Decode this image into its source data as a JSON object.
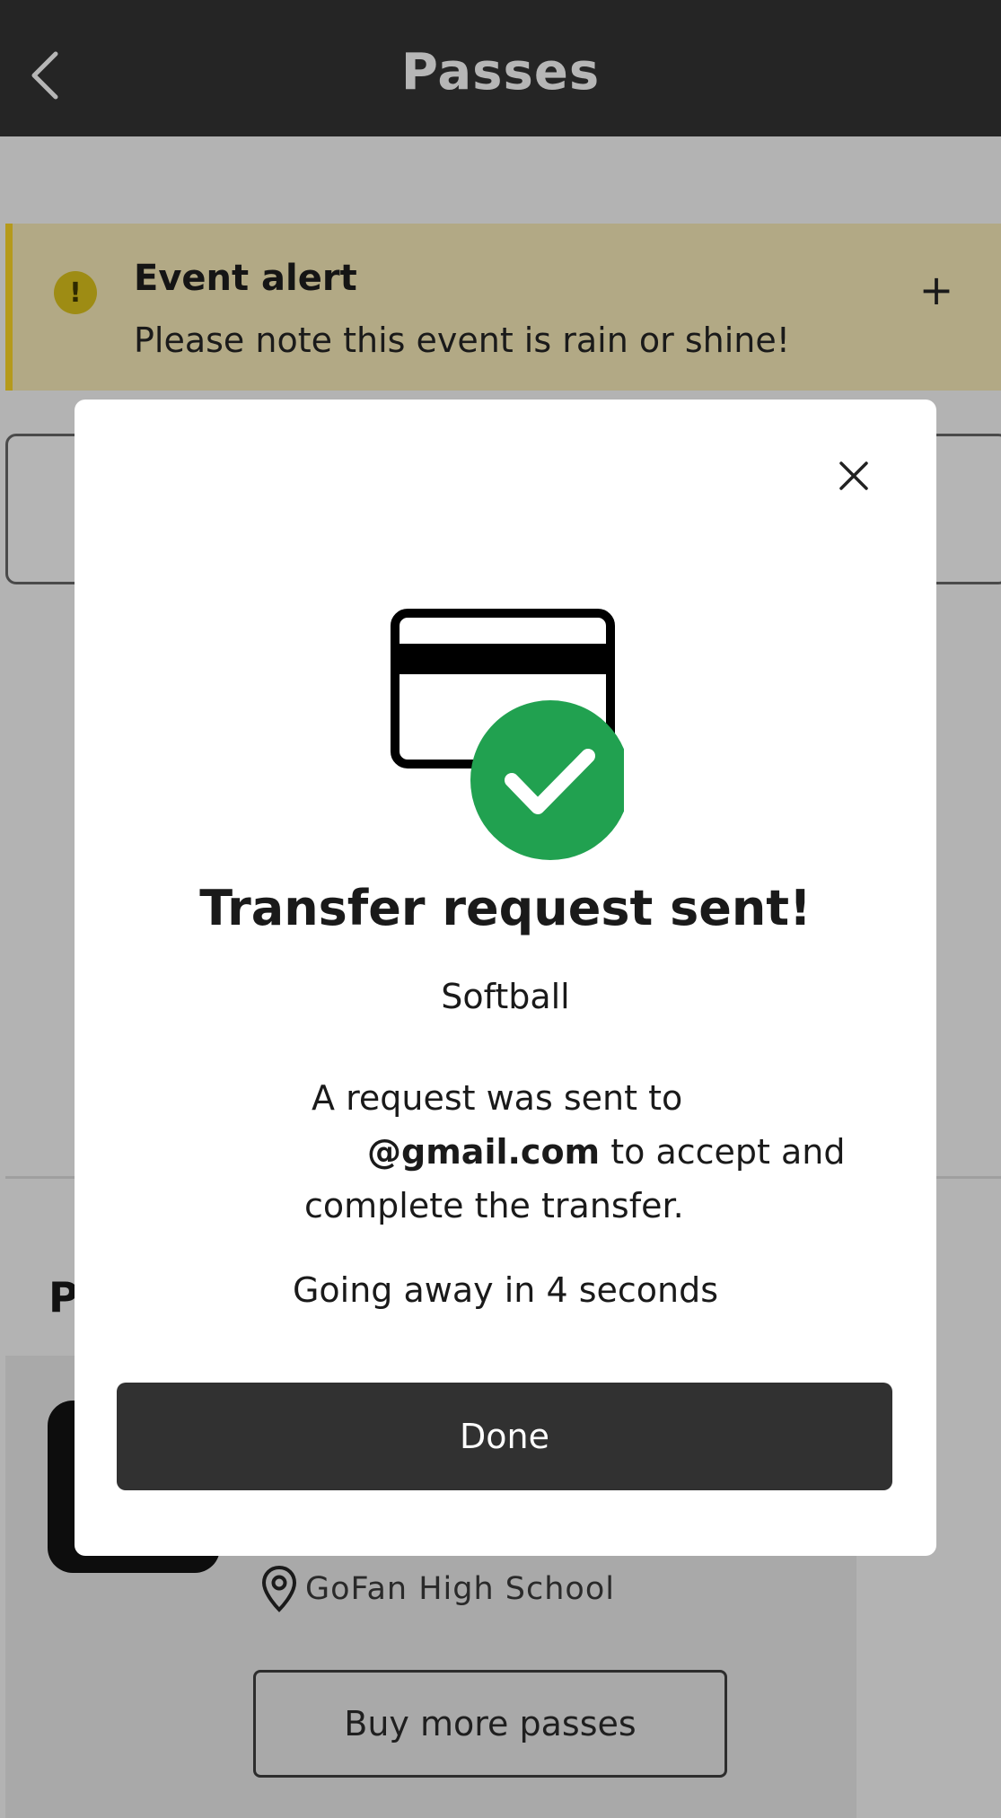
{
  "header": {
    "title": "Passes",
    "back_icon": "chevron-left-icon"
  },
  "alert": {
    "title": "Event alert",
    "message": "Please note this event is rain or shine!",
    "icon": "exclamation-icon",
    "expand_symbol": "+",
    "colors": {
      "background": "#b2a985",
      "accent": "#b59a1c"
    }
  },
  "background_page": {
    "section_heading_partial": "P",
    "location": "GoFan High School",
    "buy_more_label": "Buy more passes"
  },
  "modal": {
    "close_icon": "close-icon",
    "hero_icon": "card-check-icon",
    "title": "Transfer request sent!",
    "event_name": "Softball",
    "message_line1": "A request was sent to",
    "email": "@gmail.com",
    "message_after_email": " to accept and",
    "message_line3": "complete the transfer.",
    "countdown": "Going away in 4 seconds",
    "done_label": "Done",
    "colors": {
      "success": "#21a150",
      "button": "#313131"
    }
  }
}
